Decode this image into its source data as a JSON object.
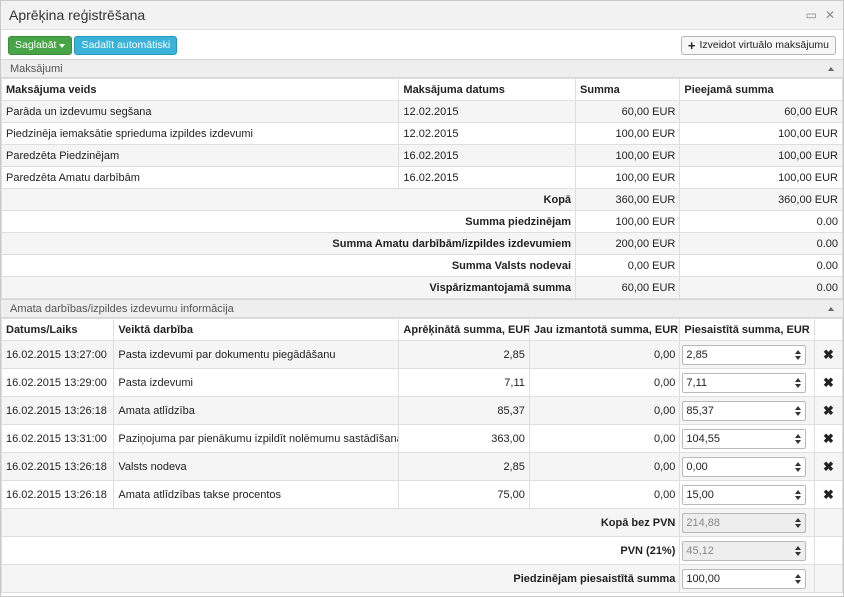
{
  "window": {
    "title": "Aprēķina reģistrēšana",
    "min_glyph": "▭",
    "close_glyph": "✕"
  },
  "toolbar": {
    "save_label": "Saglabāt",
    "split_label": "Sadalīt automātiski",
    "virtual_label": "Izveidot virtuālo maksājumu"
  },
  "payments": {
    "section_title": "Maksājumi",
    "headers": [
      "Maksājuma veids",
      "Maksājuma datums",
      "Summa",
      "Pieejamā summa"
    ],
    "rows": [
      {
        "type": "Parāda un izdevumu segšana",
        "date": "12.02.2015",
        "sum": "60,00 EUR",
        "available": "60,00 EUR"
      },
      {
        "type": "Piedzinēja iemaksātie sprieduma izpildes izdevumi",
        "date": "12.02.2015",
        "sum": "100,00 EUR",
        "available": "100,00 EUR"
      },
      {
        "type": "Paredzēta Piedzinējam",
        "date": "16.02.2015",
        "sum": "100,00 EUR",
        "available": "100,00 EUR"
      },
      {
        "type": "Paredzēta Amatu darbībām",
        "date": "16.02.2015",
        "sum": "100,00 EUR",
        "available": "100,00 EUR"
      }
    ],
    "summary": [
      {
        "label": "Kopā",
        "sum": "360,00 EUR",
        "available": "360,00 EUR"
      },
      {
        "label": "Summa piedzinējam",
        "sum": "100,00 EUR",
        "available": "0.00"
      },
      {
        "label": "Summa Amatu darbībām/izpildes izdevumiem",
        "sum": "200,00 EUR",
        "available": "0.00"
      },
      {
        "label": "Summa Valsts nodevai",
        "sum": "0,00 EUR",
        "available": "0.00"
      },
      {
        "label": "Vispārizmantojamā summa",
        "sum": "60,00 EUR",
        "available": "0.00"
      }
    ]
  },
  "actions": {
    "section_title": "Amata darbības/izpildes izdevumu informācija",
    "headers": [
      "Datums/Laiks",
      "Veiktā darbība",
      "Aprēķinātā summa, EUR",
      "Jau izmantotā summa, EUR",
      "Piesaistītā summa, EUR"
    ],
    "rows": [
      {
        "datetime": "16.02.2015 13:27:00",
        "action": "Pasta izdevumi par dokumentu piegādāšanu",
        "calc": "2,85",
        "used": "0,00",
        "assigned": "2,85"
      },
      {
        "datetime": "16.02.2015 13:29:00",
        "action": "Pasta izdevumi",
        "calc": "7,11",
        "used": "0,00",
        "assigned": "7,11"
      },
      {
        "datetime": "16.02.2015 13:26:18",
        "action": "Amata atlīdzība",
        "calc": "85,37",
        "used": "0,00",
        "assigned": "85,37"
      },
      {
        "datetime": "16.02.2015 13:31:00",
        "action": "Paziņojuma par pienākumu izpildīt nolēmumu sastādīšana",
        "calc": "363,00",
        "used": "0,00",
        "assigned": "104,55"
      },
      {
        "datetime": "16.02.2015 13:26:18",
        "action": "Valsts nodeva",
        "calc": "2,85",
        "used": "0,00",
        "assigned": "0,00"
      },
      {
        "datetime": "16.02.2015 13:26:18",
        "action": "Amata atlīdzības takse procentos",
        "calc": "75,00",
        "used": "0,00",
        "assigned": "15,00"
      }
    ],
    "delete_glyph": "✖",
    "totals": [
      {
        "label": "Kopā bez PVN",
        "value": "214,88",
        "disabled": true
      },
      {
        "label": "PVN (21%)",
        "value": "45,12",
        "disabled": true
      },
      {
        "label": "Piedzinējam piesaistītā summa",
        "value": "100,00",
        "disabled": false
      }
    ]
  }
}
